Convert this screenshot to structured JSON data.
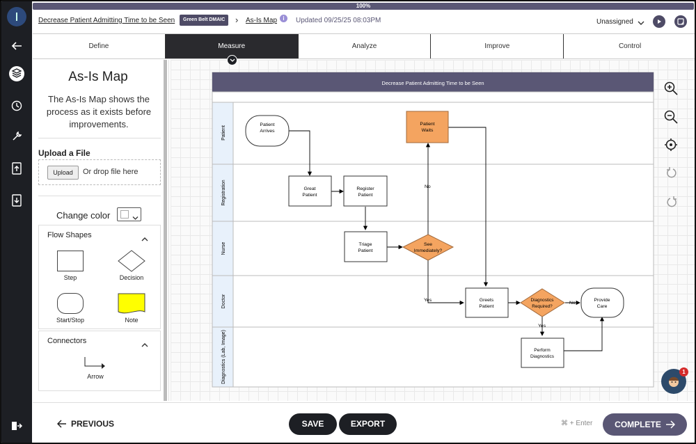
{
  "progress": {
    "label": "100%",
    "value": 100
  },
  "header": {
    "project_title": "Decrease Patient Admitting Time to be Seen",
    "badge": "Green Belt DMAIC",
    "breadcrumb_sep": "›",
    "page": "As-Is Map",
    "info_icon": "info-icon",
    "updated": "Updated 09/25/25 08:03PM",
    "assignee": "Unassigned"
  },
  "tabs": [
    "Define",
    "Measure",
    "Analyze",
    "Improve",
    "Control"
  ],
  "active_tab": "Measure",
  "sidebar": {
    "title": "As-Is Map",
    "description": "The As-Is Map shows the process as it exists before improvements.",
    "upload_heading": "Upload a File",
    "upload_button": "Upload",
    "drop_text": "Or drop file here",
    "change_color": "Change color",
    "flow_shapes_heading": "Flow Shapes",
    "shapes": [
      "Step",
      "Decision",
      "Start/Stop",
      "Note"
    ],
    "connectors_heading": "Connectors",
    "connector": "Arrow"
  },
  "diagram": {
    "title": "Decrease Patient Admitting Time to be Seen",
    "lanes": [
      "Patient",
      "Registration",
      "Nurse",
      "Doctor",
      "Diagnostics (Lab, Image)"
    ],
    "nodes": {
      "patient_arrives": "Patient Arrives",
      "patient_waits": "Patient Waits",
      "great_patient": "Great Patient",
      "register_patient": "Register Patient",
      "triage_patient": "Triage Patient",
      "see_immediately": "See Immediately?",
      "greets_patient": "Greets Patient",
      "diagnostics_required": "Diagnostics Required?",
      "provide_care": "Provide Care",
      "perform_diagnostics": "Perform Diagnostics"
    },
    "edge_labels": {
      "no1": "No",
      "yes1": "Yes",
      "no2": "No",
      "yes2": "Yes"
    },
    "colors": {
      "decision": "#f4a460",
      "header": "#5a5775",
      "lane": "#e8f1fb"
    }
  },
  "footer": {
    "previous": "PREVIOUS",
    "save": "SAVE",
    "export": "EXPORT",
    "shortcut": "⌘ + Enter",
    "complete": "COMPLETE"
  },
  "notification_count": "1"
}
